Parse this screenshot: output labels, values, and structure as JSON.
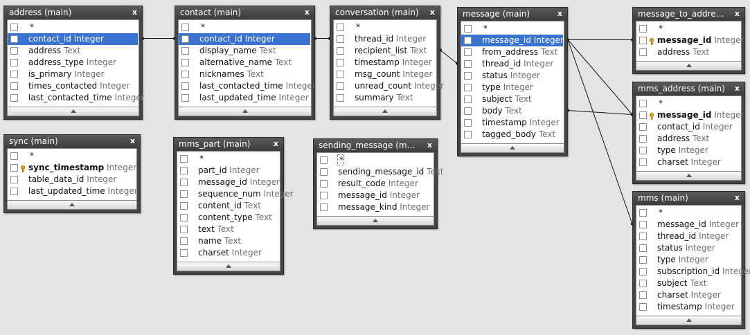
{
  "close_glyph": "x",
  "star_label": "*",
  "tables": [
    {
      "id": "address",
      "title": "address (main)",
      "fields": [
        {
          "name": "contact_id",
          "type": "Integer",
          "selected": true
        },
        {
          "name": "address",
          "type": "Text"
        },
        {
          "name": "address_type",
          "type": "Integer"
        },
        {
          "name": "is_primary",
          "type": "Integer"
        },
        {
          "name": "times_contacted",
          "type": "Integer"
        },
        {
          "name": "last_contacted_time",
          "type": "Integer"
        }
      ]
    },
    {
      "id": "contact",
      "title": "contact (main)",
      "fields": [
        {
          "name": "contact_id",
          "type": "Integer",
          "selected": true
        },
        {
          "name": "display_name",
          "type": "Text"
        },
        {
          "name": "alternative_name",
          "type": "Text"
        },
        {
          "name": "nicknames",
          "type": "Text"
        },
        {
          "name": "last_contacted_time",
          "type": "Integer"
        },
        {
          "name": "last_updated_time",
          "type": "Integer"
        }
      ]
    },
    {
      "id": "conversation",
      "title": "conversation (main)",
      "fields": [
        {
          "name": "thread_id",
          "type": "Integer"
        },
        {
          "name": "recipient_list",
          "type": "Text"
        },
        {
          "name": "timestamp",
          "type": "Integer"
        },
        {
          "name": "msg_count",
          "type": "Integer"
        },
        {
          "name": "unread_count",
          "type": "Integer"
        },
        {
          "name": "summary",
          "type": "Text"
        }
      ]
    },
    {
      "id": "message",
      "title": "message (main)",
      "fields": [
        {
          "name": "message_id",
          "type": "Integer",
          "selected": true
        },
        {
          "name": "from_address",
          "type": "Text"
        },
        {
          "name": "thread_id",
          "type": "Integer"
        },
        {
          "name": "status",
          "type": "Integer"
        },
        {
          "name": "type",
          "type": "Integer"
        },
        {
          "name": "subject",
          "type": "Text"
        },
        {
          "name": "body",
          "type": "Text"
        },
        {
          "name": "timestamp",
          "type": "Integer"
        },
        {
          "name": "tagged_body",
          "type": "Text"
        }
      ]
    },
    {
      "id": "message_to_address",
      "title": "message_to_address (main)",
      "fields": [
        {
          "name": "message_id",
          "type": "Integer",
          "pk": true
        },
        {
          "name": "address",
          "type": "Text"
        }
      ]
    },
    {
      "id": "mms_address",
      "title": "mms_address (main)",
      "fields": [
        {
          "name": "message_id",
          "type": "Integer",
          "pk": true
        },
        {
          "name": "contact_id",
          "type": "Integer"
        },
        {
          "name": "address",
          "type": "Text"
        },
        {
          "name": "type",
          "type": "Integer"
        },
        {
          "name": "charset",
          "type": "Integer"
        }
      ]
    },
    {
      "id": "sync",
      "title": "sync (main)",
      "fields": [
        {
          "name": "sync_timestamp",
          "type": "Integer",
          "pk": true
        },
        {
          "name": "table_data_id",
          "type": "Integer"
        },
        {
          "name": "last_updated_time",
          "type": "Integer"
        }
      ]
    },
    {
      "id": "mms_part",
      "title": "mms_part (main)",
      "fields": [
        {
          "name": "part_id",
          "type": "Integer"
        },
        {
          "name": "message_id",
          "type": "Integer"
        },
        {
          "name": "sequence_num",
          "type": "Integer"
        },
        {
          "name": "content_id",
          "type": "Text"
        },
        {
          "name": "content_type",
          "type": "Text"
        },
        {
          "name": "text",
          "type": "Text"
        },
        {
          "name": "name",
          "type": "Text"
        },
        {
          "name": "charset",
          "type": "Integer"
        }
      ]
    },
    {
      "id": "sending_message",
      "title": "sending_message (main)",
      "star_dotted": true,
      "fields": [
        {
          "name": "sending_message_id",
          "type": "Text"
        },
        {
          "name": "result_code",
          "type": "Integer"
        },
        {
          "name": "message_id",
          "type": "Integer"
        },
        {
          "name": "message_kind",
          "type": "Integer"
        }
      ]
    },
    {
      "id": "mms",
      "title": "mms (main)",
      "fields": [
        {
          "name": "message_id",
          "type": "Integer"
        },
        {
          "name": "thread_id",
          "type": "Integer"
        },
        {
          "name": "status",
          "type": "Integer"
        },
        {
          "name": "type",
          "type": "Integer"
        },
        {
          "name": "subscription_id",
          "type": "Integer"
        },
        {
          "name": "subject",
          "type": "Text"
        },
        {
          "name": "charset",
          "type": "Integer"
        },
        {
          "name": "timestamp",
          "type": "Integer"
        }
      ]
    }
  ],
  "relations": [
    {
      "from_table": "contact",
      "from_field": "contact_id",
      "to_table": "address",
      "to_field": "contact_id"
    },
    {
      "from_table": "conversation",
      "from_field": "thread_id",
      "to_table": "contact",
      "to_field": "contact_id"
    },
    {
      "from_table": "conversation",
      "from_field": "recipient_list",
      "to_table": "message",
      "to_field": "thread_id"
    },
    {
      "from_table": "message",
      "from_field": "message_id",
      "to_table": "message_to_address",
      "to_field": "message_id"
    },
    {
      "from_table": "message",
      "from_field": "message_id",
      "to_table": "mms_address",
      "to_field": "message_id"
    },
    {
      "from_table": "message",
      "from_field": "body",
      "to_table": "mms_address",
      "to_field": "message_id"
    },
    {
      "from_table": "message",
      "from_field": "message_id",
      "to_table": "mms",
      "to_field": "message_id"
    }
  ]
}
